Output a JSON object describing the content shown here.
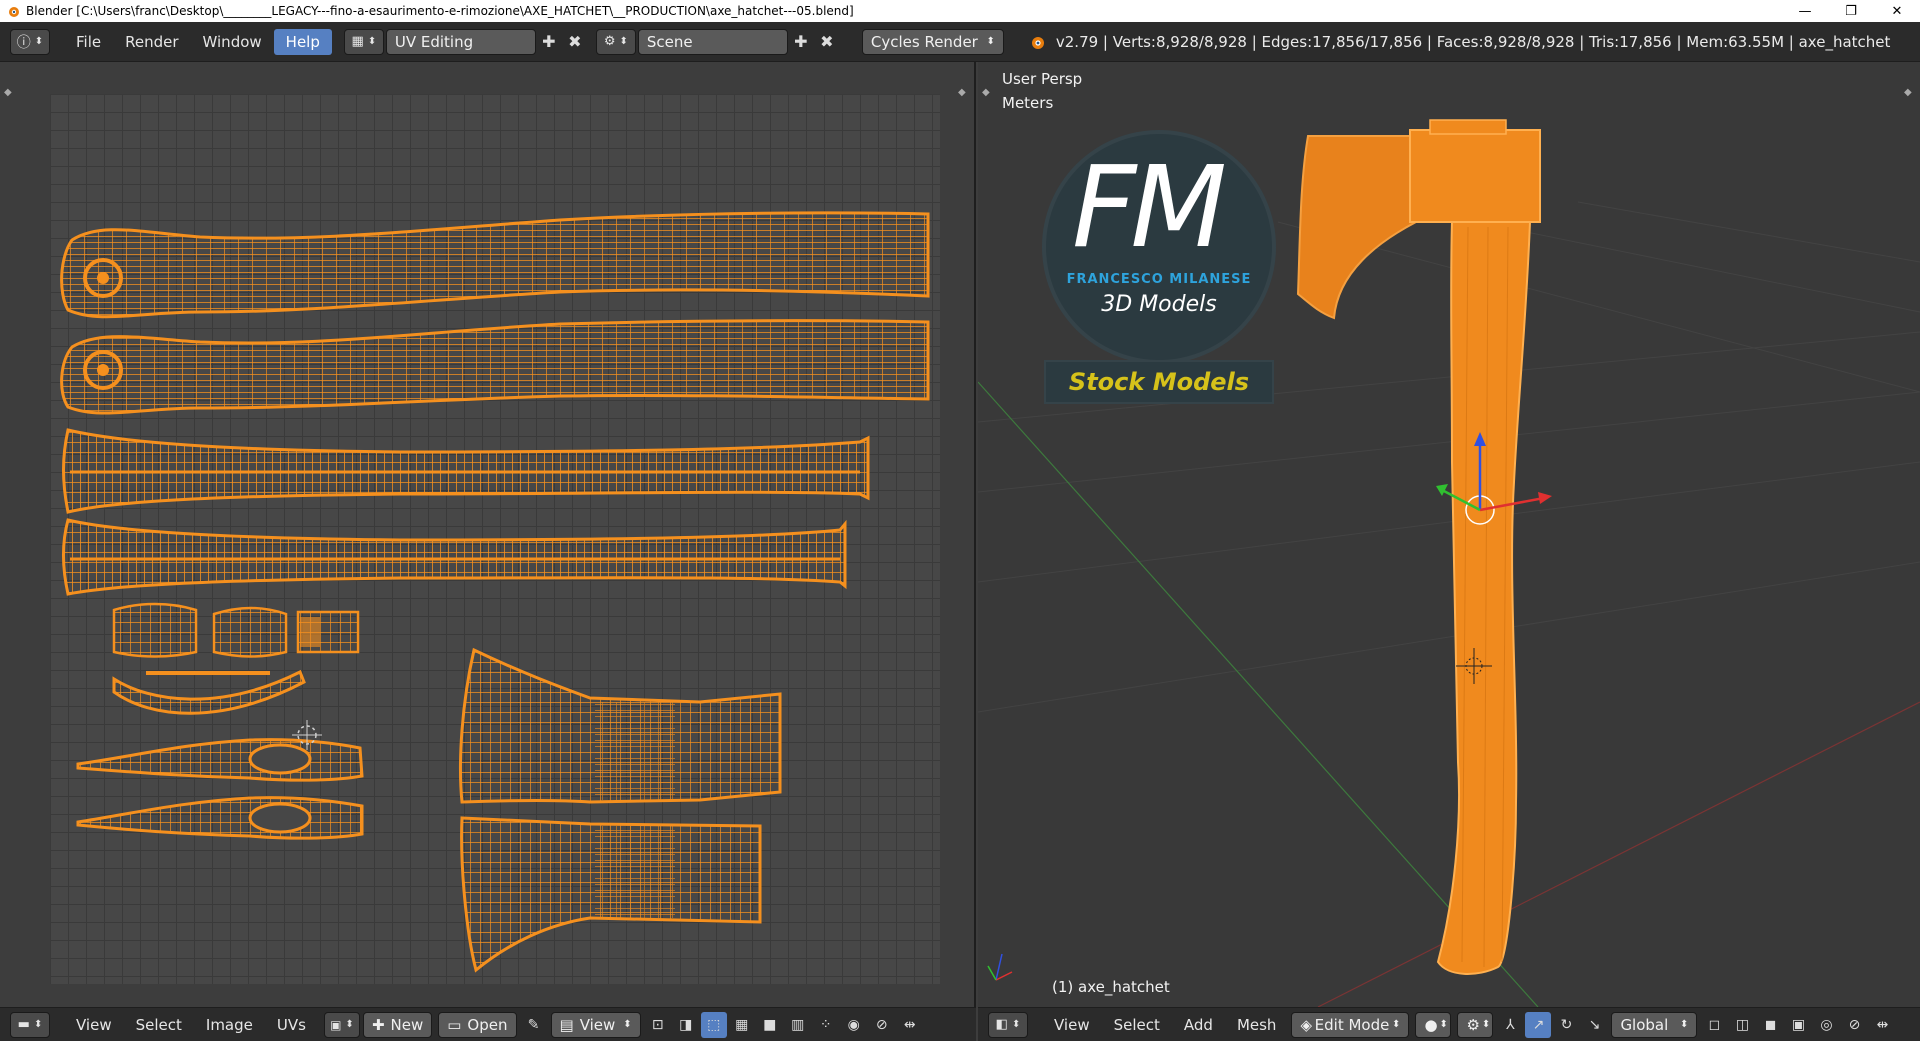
{
  "window": {
    "title": "Blender [C:\\Users\\franc\\Desktop\\________LEGACY---fino-a-esaurimento-e-rimozione\\AXE_HATCHET\\__PRODUCTION\\axe_hatchet---05.blend]",
    "minimize": "—",
    "maximize": "❐",
    "close": "✕"
  },
  "topbar": {
    "menus": [
      "File",
      "Render",
      "Window",
      "Help"
    ],
    "active_menu": "Help",
    "layout": "UV Editing",
    "scene": "Scene",
    "engine": "Cycles Render",
    "stats": "v2.79 | Verts:8,928/8,928 | Edges:17,856/17,856 | Faces:8,928/8,928 | Tris:17,856 | Mem:63.55M | axe_hatchet"
  },
  "viewport": {
    "view_name": "User Persp",
    "units": "Meters",
    "object_label": "(1) axe_hatchet",
    "logo": {
      "letters": "FM",
      "brand": "FRANCESCO MILANESE",
      "subtitle": "3D Models",
      "banner": "Stock Models"
    }
  },
  "uv_bottom": {
    "menus": [
      "View",
      "Select",
      "Image",
      "UVs"
    ],
    "new_label": "New",
    "open_label": "Open",
    "view_label": "View"
  },
  "vp_bottom": {
    "menus": [
      "View",
      "Select",
      "Add",
      "Mesh"
    ],
    "mode": "Edit Mode",
    "orientation": "Global"
  },
  "colors": {
    "mesh": "#f5901e",
    "accent": "#5680c2",
    "logo_blue": "#2ea3dc",
    "banner_yellow": "#d6c21a"
  }
}
